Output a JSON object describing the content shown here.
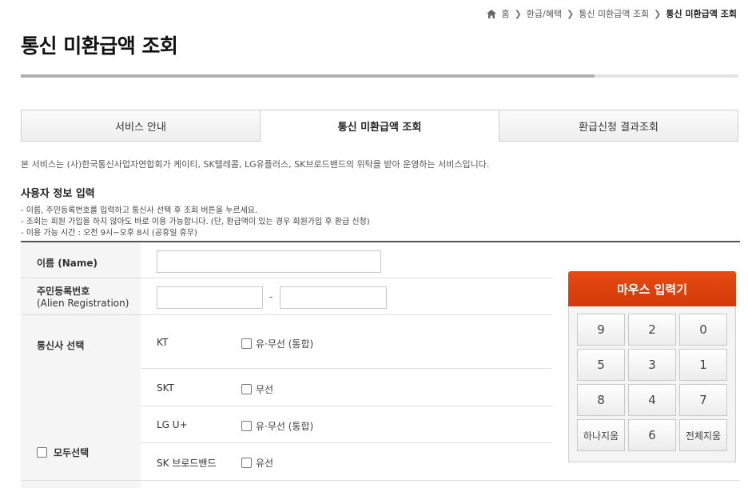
{
  "breadcrumb": {
    "home": "홈",
    "level1": "환급/혜택",
    "level2": "통신 미환급액 조회",
    "current": "통신 미환급액 조회"
  },
  "page_title": "통신 미환급액 조회",
  "progress": {
    "fraction": 0.8
  },
  "tabs": [
    {
      "label": "서비스 안내"
    },
    {
      "label": "통신 미환급액 조회"
    },
    {
      "label": "환급신청 결과조회"
    }
  ],
  "description": "본 서비스는 (사)한국통신사업자연합회가 케이티, SK텔레콤, LG유플러스, SK브로드밴드의 위탁을 받아 운영하는 서비스입니다.",
  "section_title": "사용자 정보 입력",
  "notes": [
    "- 이름, 주민등록번호를 입력하고 통신사 선택 후 조회 버튼을 누르세요.",
    "- 조회는 회원 가입을 하지 않아도 바로 이용 가능합니다. (단, 환급액이 있는 경우 회원가입 후 환급 신청)",
    "- 이용 가능 시간 : 오전 9시~오후 8시 (공휴일 휴무)"
  ],
  "form": {
    "name_label": "이름 (Name)",
    "name_value": "",
    "id_label": "주민등록번호",
    "id_sub": "(Alien Registration)",
    "id_front": "",
    "id_back": "",
    "id_dash": "-",
    "carrier_label": "통신사 선택",
    "select_all": "모두선택",
    "carriers": [
      {
        "name": "KT",
        "option": "유·무선 (통합)"
      },
      {
        "name": "SKT",
        "option": "무선"
      },
      {
        "name": "LG U+",
        "option": "유·무선 (통합)"
      },
      {
        "name": "SK 브로드밴드",
        "option": "유선"
      }
    ]
  },
  "keypad": {
    "title": "마우스 입력기",
    "keys": [
      "9",
      "2",
      "0",
      "5",
      "3",
      "1",
      "8",
      "4",
      "7",
      "하나지움",
      "6",
      "전체지움"
    ]
  }
}
